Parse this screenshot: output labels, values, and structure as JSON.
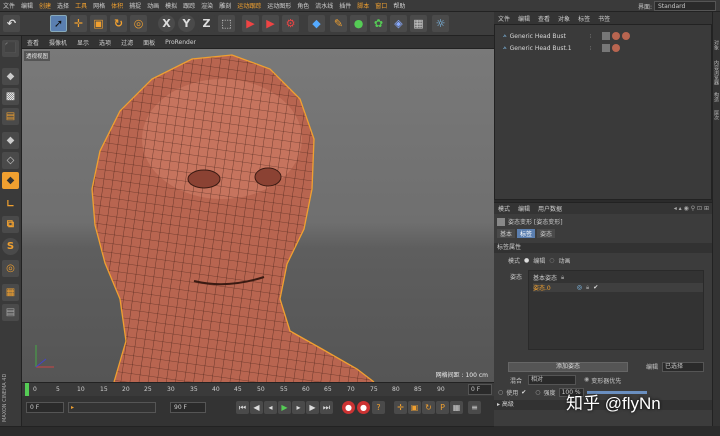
{
  "menubar": {
    "items": [
      "文件",
      "编辑",
      "创建",
      "选择",
      "工具",
      "网格",
      "体积",
      "捕捉",
      "动画",
      "模拟",
      "跟踪",
      "渲染",
      "雕刻",
      "运动跟踪",
      "运动图形",
      "角色",
      "流水线",
      "插件",
      "脚本",
      "窗口",
      "帮助"
    ],
    "highlight_items": [
      "创建",
      "工具",
      "体积",
      "运动跟踪",
      "脚本",
      "窗口"
    ],
    "layout_label": "界面:",
    "layout_value": "Standard"
  },
  "toolbar": {
    "icons": [
      "undo-icon",
      "select-arrow-icon",
      "move-icon",
      "scale-icon",
      "rotate-icon",
      "recent-tools-icon",
      "axis-x-icon",
      "axis-y-icon",
      "axis-z-icon",
      "coordinate-icon",
      "render-region-icon",
      "render-view-icon",
      "render-settings-icon",
      "cube-icon",
      "pen-icon",
      "generator-icon",
      "deformer-icon",
      "scene-icon",
      "camera-icon",
      "light-icon"
    ]
  },
  "left_toolbar": {
    "icons": [
      "make-editable-icon",
      "model-mode-icon",
      "texture-mode-icon",
      "workplane-icon",
      "points-mode-icon",
      "edges-mode-icon",
      "polygons-mode-icon",
      "axis-mode-icon",
      "tweak-icon",
      "snap-icon",
      "solo-icon",
      "magnet-icon",
      "grid-icon",
      "floor-grid-icon"
    ]
  },
  "viewport": {
    "menu": [
      "查看",
      "摄像机",
      "显示",
      "选项",
      "过滤",
      "面板",
      "ProRender"
    ],
    "label": "透视视图",
    "grid_spacing": "网格间距 : 100 cm"
  },
  "timeline": {
    "ticks": [
      "0",
      "5",
      "10",
      "15",
      "20",
      "25",
      "30",
      "35",
      "40",
      "45",
      "50",
      "55",
      "60",
      "65",
      "70",
      "75",
      "80",
      "85",
      "90"
    ],
    "end_frame": "0 F"
  },
  "playbar": {
    "start": "0 F",
    "current": "0 F",
    "min": "90 F",
    "max": "90 F"
  },
  "object_manager": {
    "tabs": [
      "文件",
      "编辑",
      "查看",
      "对象",
      "标签",
      "书签"
    ],
    "objects": [
      "Generic Head Bust",
      "Generic Head Bust.1"
    ]
  },
  "right_strip": {
    "labels": [
      "对象",
      "内容浏览器",
      "构造",
      "层次"
    ]
  },
  "attribute_manager": {
    "tabs": [
      "模式",
      "编辑",
      "用户数据"
    ],
    "title": "姿态变形 [姿态变形]",
    "subtabs": [
      "基本",
      "标签",
      "姿态"
    ],
    "section": "标签属性",
    "mode_label": "模式",
    "mode_edit": "编辑",
    "mode_animate": "动画",
    "pose_label": "姿态",
    "pose_base": "基本姿态",
    "pose_0": "姿态.0",
    "add_pose_button": "添加姿态",
    "edit_label": "编辑",
    "edit_value": "已选择",
    "mix_label": "混合",
    "mix_value": "相对",
    "deform_order": "变形器优先",
    "use_label": "使用",
    "strength_label": "强度",
    "strength_value": "100 %",
    "advanced": "高级"
  },
  "watermark": "知乎 @flyNn",
  "brand": "MAXON CINEMA 4D"
}
